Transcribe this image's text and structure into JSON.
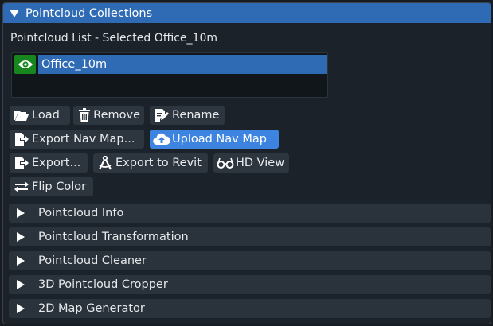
{
  "panel": {
    "title": "Pointcloud Collections"
  },
  "list": {
    "label": "Pointcloud List - Selected Office_10m",
    "items": [
      {
        "name": "Office_10m",
        "visible": true,
        "selected": true
      }
    ]
  },
  "buttons": {
    "load": "Load",
    "remove": "Remove",
    "rename": "Rename",
    "export_nav_map": "Export Nav Map...",
    "upload_nav_map": "Upload Nav Map",
    "export": "Export...",
    "export_revit": "Export to Revit",
    "hd_view": "HD View",
    "flip_color": "Flip Color"
  },
  "sections": [
    {
      "label": "Pointcloud Info"
    },
    {
      "label": "Pointcloud Transformation"
    },
    {
      "label": "Pointcloud Cleaner"
    },
    {
      "label": "3D Pointcloud Cropper"
    },
    {
      "label": "2D Map Generator"
    }
  ],
  "colors": {
    "accent": "#2f6bb4",
    "active_button": "#3d83e0",
    "visible_toggle": "#17861f",
    "background": "#1b2229"
  }
}
